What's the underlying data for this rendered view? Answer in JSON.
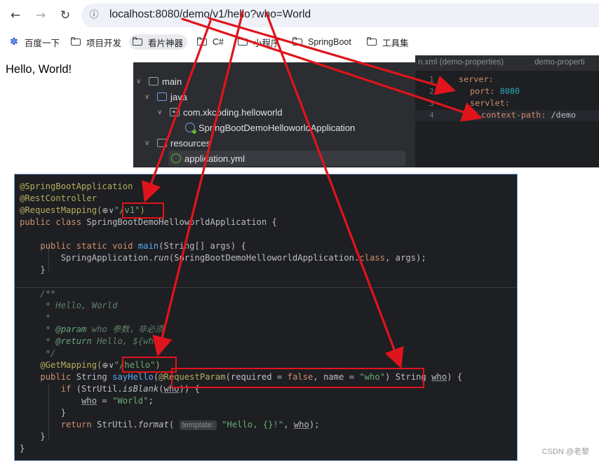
{
  "browser": {
    "url": "localhost:8080/demo/v1/hello?who=World",
    "bookmarks": [
      {
        "label": "百度一下",
        "icon": "paw-icon"
      },
      {
        "label": "项目开发",
        "icon": "folder-icon"
      },
      {
        "label": "看片神器",
        "icon": "folder-icon"
      },
      {
        "label": "C#",
        "icon": "folder-icon"
      },
      {
        "label": "小程序",
        "icon": "folder-icon"
      },
      {
        "label": "SpringBoot",
        "icon": "folder-icon"
      },
      {
        "label": "工具集",
        "icon": "folder-icon"
      }
    ],
    "page_text": "Hello, World!"
  },
  "project_tree": {
    "items": [
      {
        "label": "main"
      },
      {
        "label": "java"
      },
      {
        "label": "com.xkcoding.helloworld"
      },
      {
        "label": "SpringBootDemoHelloworldApplication"
      },
      {
        "label": "resources"
      },
      {
        "label": "application.yml"
      }
    ]
  },
  "yml_editor": {
    "tab1": "n.xml (demo-properties)",
    "tab2": "demo-properti",
    "line_numbers": [
      "1",
      "2",
      "3",
      "4"
    ],
    "server_key": "server:",
    "port_key": "port:",
    "port_value": "8080",
    "servlet_key": "servlet:",
    "context_path_key": "context-path:",
    "context_path_value": "/demo"
  },
  "code": {
    "ann_app": "@SpringBootApplication",
    "ann_rest": "@RestController",
    "ann_reqmap": "@RequestMapping(",
    "reqmap_value": "\"/v1\"",
    "class_kw": "public class ",
    "class_name": "SpringBootDemoHelloworldApplication {",
    "main_kw": "public static void ",
    "main_fn": "main",
    "main_args": "(String[] args) {",
    "run_prefix": "SpringApplication.",
    "run_fn": "run",
    "run_args": "(SpringBootDemoHelloworldApplication.",
    "run_class_kw": "class",
    "run_end": ", args);",
    "close_brace": "}",
    "doc_open": "/**",
    "doc_title": " * Hello, World",
    "doc_empty": " *",
    "doc_param_star": " * ",
    "doc_param_tag": "@param",
    "doc_param_text": " who 参数，非必须",
    "doc_return_star": " * ",
    "doc_return_tag": "@return",
    "doc_return_text": " Hello, ${who}",
    "doc_close": " */",
    "ann_get": "@GetMapping(",
    "get_value": "\"/hello\"",
    "paren_close": ")",
    "method_kw": "public ",
    "method_type": "String ",
    "method_fn": "sayHello",
    "method_open": "(",
    "ann_param": "@RequestParam",
    "param_open": "(required = ",
    "param_false": "false",
    "param_mid": ", name = ",
    "param_name": "\"who\"",
    "param_end": ") String ",
    "param_who": "who",
    "param_tail": ") {",
    "if_kw": "if ",
    "if_open": "(StrUtil.",
    "if_fn": "isBlank",
    "if_arg_open": "(",
    "if_who": "who",
    "if_close": ")) {",
    "assign_who": "who",
    "assign_eq": " = ",
    "assign_value": "\"World\"",
    "semicolon": ";",
    "return_kw": "return ",
    "return_prefix": "StrUtil.",
    "return_fn": "format",
    "return_open": "( ",
    "hint_template": "template:",
    "return_str": " \"Hello, {}!\"",
    "return_comma": ", ",
    "return_who": "who",
    "return_end": ");",
    "globe": "⊕∨"
  },
  "watermark": "CSDN @老黎"
}
